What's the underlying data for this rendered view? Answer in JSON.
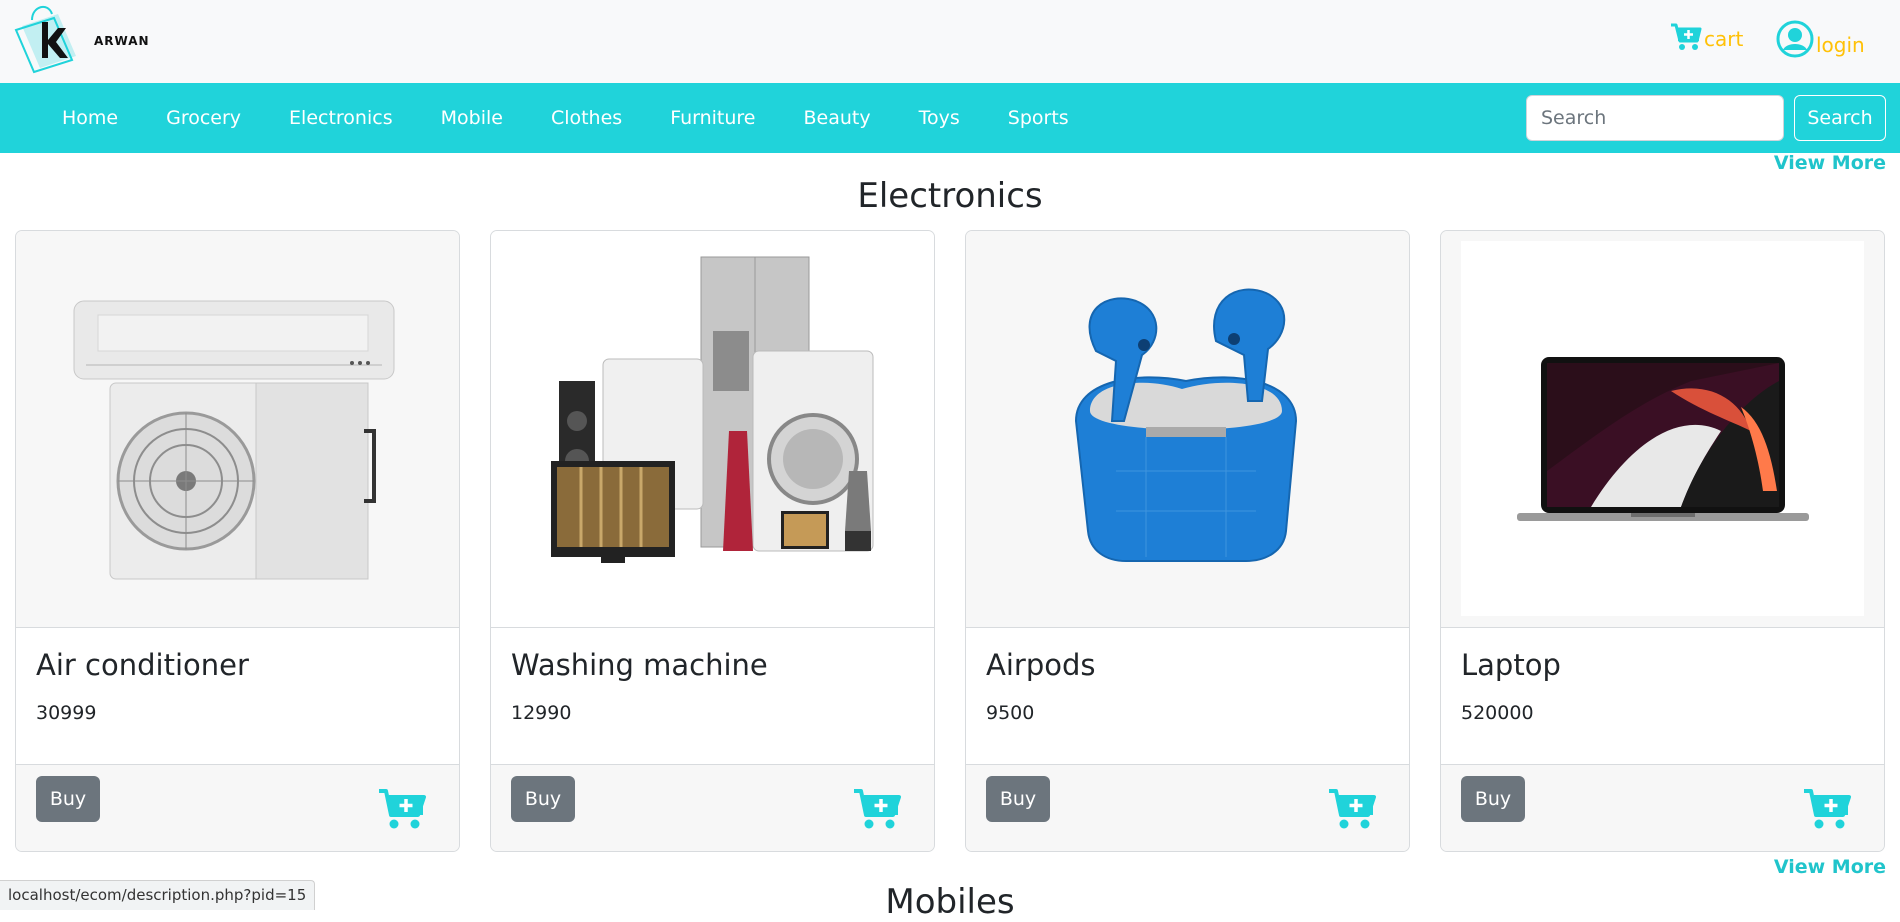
{
  "header": {
    "logo_text": "ARWAN",
    "cart_label": "cart",
    "login_label": "login"
  },
  "nav": {
    "items": [
      "Home",
      "Grocery",
      "Electronics",
      "Mobile",
      "Clothes",
      "Furniture",
      "Beauty",
      "Toys",
      "Sports"
    ],
    "search_placeholder": "Search",
    "search_button": "Search"
  },
  "electronics": {
    "view_more": "View More",
    "title": "Electronics",
    "products": [
      {
        "name": "Air conditioner",
        "price": "30999",
        "buy": "Buy"
      },
      {
        "name": "Washing machine",
        "price": "12990",
        "buy": "Buy"
      },
      {
        "name": "Airpods",
        "price": "9500",
        "buy": "Buy"
      },
      {
        "name": "Laptop",
        "price": "520000",
        "buy": "Buy"
      }
    ]
  },
  "mobiles": {
    "view_more": "View More",
    "title": "Mobiles"
  },
  "status_bar": {
    "url": "localhost/ecom/description.php?pid=15"
  },
  "colors": {
    "accent": "#20d3da",
    "link_yellow": "#ffc107",
    "button_gray": "#6c757d"
  }
}
